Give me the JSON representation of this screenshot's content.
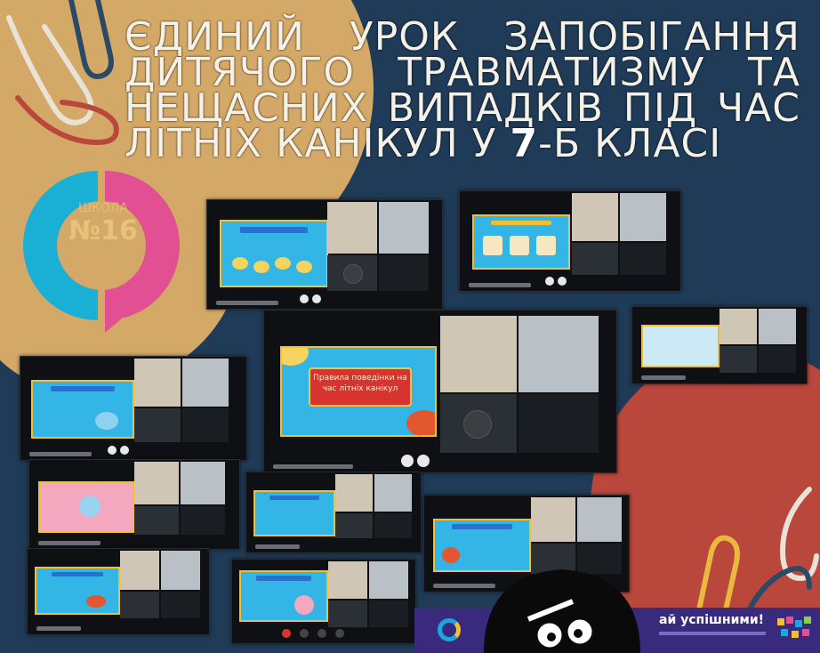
{
  "title": {
    "lines": [
      "ЄДИНИЙ УРОК ЗАПОБІГАННЯ",
      "ДИТЯЧОГО ТРАВМАТИЗМУ ТА",
      "НЕЩАСНИХ ВИПАДКІВ ПІД ЧАС"
    ],
    "last_line_before": "ЛІТНІХ КАНІКУЛ У ",
    "last_line_digit": "7",
    "last_line_after": "-Б КЛАСІ"
  },
  "logo": {
    "school": "ШКОЛА",
    "number": "№16"
  },
  "center_slide_callout": "Правила поведінки на час літніх канікул",
  "banner": {
    "text": "ай успішними!"
  },
  "colors": {
    "background": "#1f3b57",
    "sand_blob": "#d4a866",
    "red_blob": "#b9473c",
    "logo_cyan": "#1ab0d6",
    "logo_pink": "#e24f92",
    "banner": "#3a2a7e"
  },
  "icons": {
    "decor_left": "paperclip-icon",
    "decor_right": "paperclip-icon",
    "mascot": "cartoon-mascot-icon"
  }
}
